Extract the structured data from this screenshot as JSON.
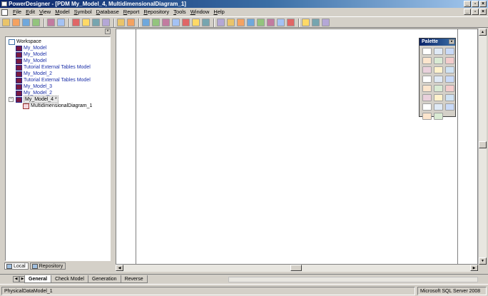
{
  "window": {
    "title": "PowerDesigner - [PDM My_Model_4, MultidimensionalDiagram_1]"
  },
  "menu": [
    "File",
    "Edit",
    "View",
    "Model",
    "Symbol",
    "Database",
    "Report",
    "Repository",
    "Tools",
    "Window",
    "Help"
  ],
  "toolbar": {
    "icons": [
      "new-icon",
      "open-icon",
      "save-icon",
      "save-all-icon",
      "print-preview-icon",
      "print-icon",
      "cut-icon",
      "copy-icon",
      "paste-icon",
      "delete-icon",
      "undo-icon",
      "redo-icon",
      "properties-icon",
      "zoom-icon",
      "check-model-icon",
      "generate-icon",
      "reverse-icon",
      "compare-icon",
      "merge-icon",
      "format-icon",
      "text-icon",
      "color-icon",
      "line-style-icon",
      "arrow-icon",
      "align-icon",
      "grid-icon",
      "layout-icon",
      "view-browser-icon",
      "view-output-icon",
      "view-palette-icon"
    ]
  },
  "browser": {
    "tree": [
      {
        "label": "Workspace",
        "type": "workspace",
        "level": 0
      },
      {
        "label": "My_Model",
        "type": "model",
        "level": 1
      },
      {
        "label": "My_Model",
        "type": "model",
        "level": 1
      },
      {
        "label": "My_Model",
        "type": "model",
        "level": 1
      },
      {
        "label": "Tutorial External Tables Model",
        "type": "model",
        "level": 1
      },
      {
        "label": "My_Model_2",
        "type": "model",
        "level": 1
      },
      {
        "label": "Tutorial External Tables Model",
        "type": "model",
        "level": 1
      },
      {
        "label": "My_Model_3",
        "type": "model",
        "level": 1
      },
      {
        "label": "My_Model_2",
        "type": "model",
        "level": 1
      },
      {
        "label": "My_Model_4 *",
        "type": "model-selected",
        "level": 1
      },
      {
        "label": "MultidimensionalDiagram_1",
        "type": "diagram",
        "level": 2
      }
    ],
    "tabs": [
      "Local",
      "Repository"
    ]
  },
  "palette": {
    "title": "Palette",
    "tools": [
      "pointer-tool-icon",
      "grabber-tool-icon",
      "zoom-in-icon",
      "zoom-out-icon",
      "open-diagram-icon",
      "properties-tool-icon",
      "delete-tool-icon",
      "package-icon",
      "cube-icon",
      "dimension-icon",
      "association-icon",
      "attribute-icon",
      "note-icon",
      "link-icon",
      "free-text-icon",
      "title-box-icon",
      "line-icon",
      "arc-icon",
      "rectangle-icon",
      "ellipse-icon",
      "rounded-rectangle-icon",
      "polyline-icon",
      "polygon-icon"
    ]
  },
  "output": {
    "tabs": [
      "General",
      "Check Model",
      "Generation",
      "Reverse"
    ]
  },
  "status": {
    "left": "PhysicalDataModel_1",
    "right": "Microsoft SQL Server 2008"
  }
}
